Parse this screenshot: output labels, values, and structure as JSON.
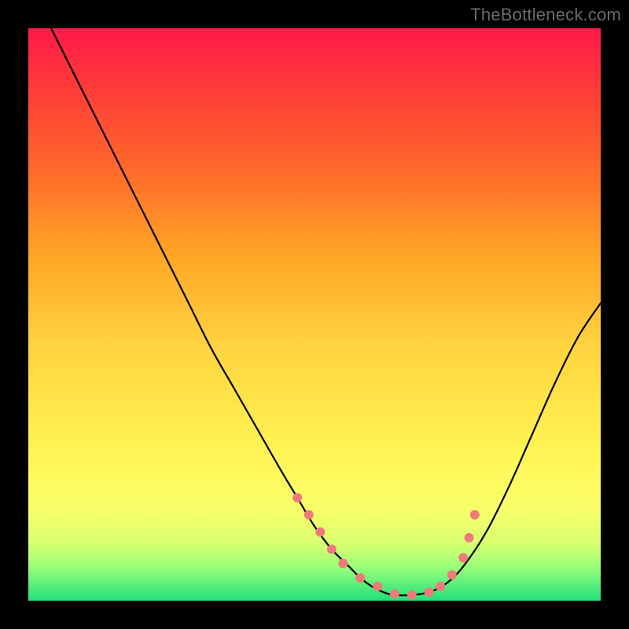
{
  "watermark": "TheBottleneck.com",
  "chart_data": {
    "type": "line",
    "title": "",
    "xlabel": "",
    "ylabel": "",
    "xlim": [
      0,
      100
    ],
    "ylim": [
      0,
      100
    ],
    "gradient_stops": [
      {
        "pct": 0,
        "color": "#ff1a4b"
      },
      {
        "pct": 10,
        "color": "#ff3a3a"
      },
      {
        "pct": 25,
        "color": "#ff6a2a"
      },
      {
        "pct": 40,
        "color": "#ffa726"
      },
      {
        "pct": 55,
        "color": "#ffd23f"
      },
      {
        "pct": 67,
        "color": "#ffe84a"
      },
      {
        "pct": 77,
        "color": "#fff85a"
      },
      {
        "pct": 84,
        "color": "#f8ff6a"
      },
      {
        "pct": 90,
        "color": "#d8ff70"
      },
      {
        "pct": 94,
        "color": "#9cff7a"
      },
      {
        "pct": 97,
        "color": "#5fef7d"
      },
      {
        "pct": 100,
        "color": "#20e078"
      }
    ],
    "series": [
      {
        "name": "bottleneck-curve",
        "color": "#000000",
        "x": [
          4,
          8,
          12,
          16,
          20,
          24,
          28,
          32,
          36,
          40,
          44,
          47,
          50,
          53,
          56,
          58,
          60,
          62,
          64,
          67,
          70,
          73,
          76,
          80,
          84,
          88,
          92,
          96,
          100
        ],
        "y": [
          100,
          92,
          84,
          76,
          68,
          60,
          52,
          44,
          37,
          30,
          23,
          18,
          13,
          9,
          6,
          4,
          2.5,
          1.5,
          1,
          1,
          1.5,
          3,
          6,
          12,
          20,
          29,
          38,
          46,
          52
        ]
      }
    ],
    "markers": {
      "name": "highlight-points",
      "color": "#ef7a7a",
      "radius": 6,
      "x": [
        47,
        49,
        51,
        53,
        55,
        58,
        61,
        64,
        67,
        70,
        72,
        74,
        76,
        77,
        78
      ],
      "y": [
        18,
        15,
        12,
        9,
        6.5,
        4,
        2.5,
        1.2,
        1,
        1.5,
        2.5,
        4.5,
        7.5,
        11,
        15
      ]
    }
  }
}
